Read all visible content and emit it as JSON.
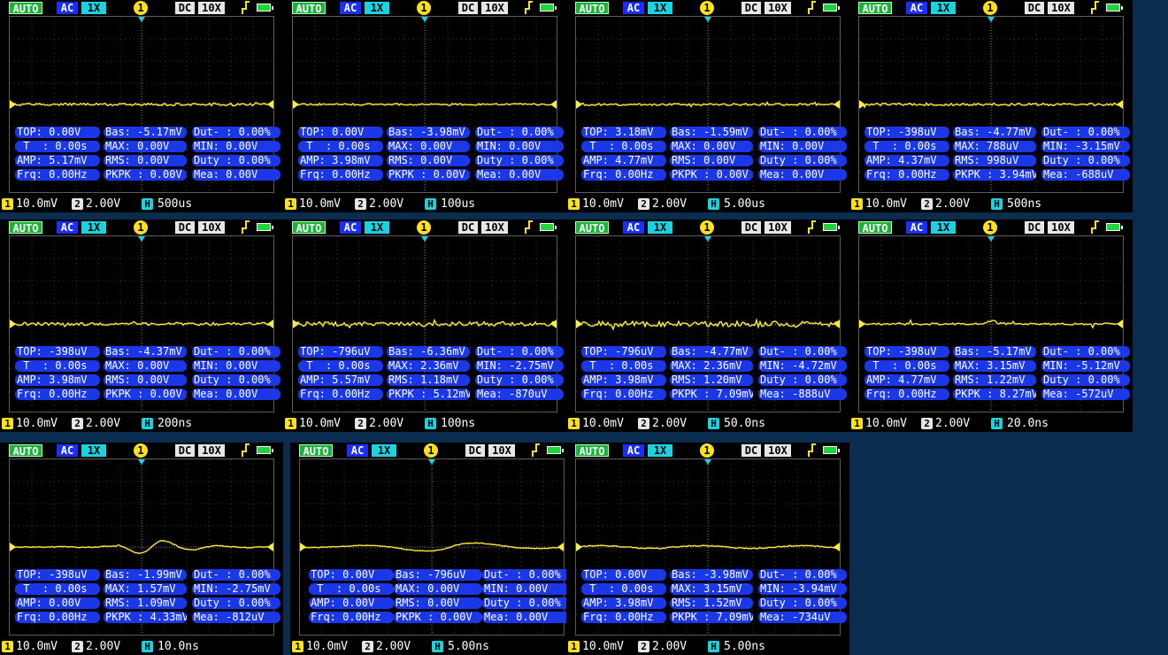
{
  "topbar": {
    "mode": "AUTO",
    "coupling": "AC",
    "probe": "1X",
    "channel": "1",
    "coupling2": "DC",
    "probe2": "10X",
    "trigger_icon": "trigger-edge-icon",
    "battery_icon": "battery-icon"
  },
  "colors": {
    "trace": "#ffeb3b",
    "stat_bg": "#1a37e8",
    "bg": "#0a2d4f"
  },
  "panels": [
    {
      "volts1": "10.0mV",
      "volts2": "2.00V",
      "timebase": "500us",
      "stats": [
        "TOP: 0.00V",
        "Bas: -5.17mV",
        "Dut- : 0.00%",
        " T  : 0.00s",
        "MAX: 0.00V",
        "MIN: 0.00V",
        "AMP: 5.17mV",
        "RMS: 0.00V",
        "Duty : 0.00%",
        "Frq: 0.00Hz",
        "PKPK : 0.00V",
        "Mea: 0.00V"
      ]
    },
    {
      "volts1": "10.0mV",
      "volts2": "2.00V",
      "timebase": "100us",
      "stats": [
        "TOP: 0.00V",
        "Bas: -3.98mV",
        "Dut- : 0.00%",
        " T  : 0.00s",
        "MAX: 0.00V",
        "MIN: 0.00V",
        "AMP: 3.98mV",
        "RMS: 0.00V",
        "Duty : 0.00%",
        "Frq: 0.00Hz",
        "PKPK : 0.00V",
        "Mea: 0.00V"
      ]
    },
    {
      "volts1": "10.0mV",
      "volts2": "2.00V",
      "timebase": "5.00us",
      "stats": [
        "TOP: 3.18mV",
        "Bas: -1.59mV",
        "Dut- : 0.00%",
        " T  : 0.00s",
        "MAX: 0.00V",
        "MIN: 0.00V",
        "AMP: 4.77mV",
        "RMS: 0.00V",
        "Duty : 0.00%",
        "Frq: 0.00Hz",
        "PKPK : 0.00V",
        "Mea: 0.00V"
      ]
    },
    {
      "volts1": "10.0mV",
      "volts2": "2.00V",
      "timebase": "500ns",
      "stats": [
        "TOP: -398uV",
        "Bas: -4.77mV",
        "Dut- : 0.00%",
        " T  : 0.00s",
        "MAX: 788uV",
        "MIN: -3.15mV",
        "AMP: 4.37mV",
        "RMS: 998uV",
        "Duty : 0.00%",
        "Frq: 0.00Hz",
        "PKPK : 3.94mV",
        "Mea: -688uV"
      ]
    },
    {
      "volts1": "10.0mV",
      "volts2": "2.00V",
      "timebase": "200ns",
      "stats": [
        "TOP: -398uV",
        "Bas: -4.37mV",
        "Dut- : 0.00%",
        " T  : 0.00s",
        "MAX: 0.00V",
        "MIN: 0.00V",
        "AMP: 3.98mV",
        "RMS: 0.00V",
        "Duty : 0.00%",
        "Frq: 0.00Hz",
        "PKPK : 0.00V",
        "Mea: 0.00V"
      ]
    },
    {
      "volts1": "10.0mV",
      "volts2": "2.00V",
      "timebase": "100ns",
      "stats": [
        "TOP: -796uV",
        "Bas: -6.36mV",
        "Dut- : 0.00%",
        " T  : 0.00s",
        "MAX: 2.36mV",
        "MIN: -2.75mV",
        "AMP: 5.57mV",
        "RMS: 1.18mV",
        "Duty : 0.00%",
        "Frq: 0.00Hz",
        "PKPK : 5.12mV",
        "Mea: -870uV"
      ]
    },
    {
      "volts1": "10.0mV",
      "volts2": "2.00V",
      "timebase": "50.0ns",
      "stats": [
        "TOP: -796uV",
        "Bas: -4.77mV",
        "Dut- : 0.00%",
        " T  : 0.00s",
        "MAX: 2.36mV",
        "MIN: -4.72mV",
        "AMP: 3.98mV",
        "RMS: 1.20mV",
        "Duty : 0.00%",
        "Frq: 0.00Hz",
        "PKPK : 7.09mV",
        "Mea: -888uV"
      ]
    },
    {
      "volts1": "10.0mV",
      "volts2": "2.00V",
      "timebase": "20.0ns",
      "stats": [
        "TOP: -398uV",
        "Bas: -5.17mV",
        "Dut- : 0.00%",
        " T  : 0.00s",
        "MAX: 3.15mV",
        "MIN: -5.12mV",
        "AMP: 4.77mV",
        "RMS: 1.22mV",
        "Duty : 0.00%",
        "Frq: 0.00Hz",
        "PKPK : 8.27mV",
        "Mea: -572uV"
      ]
    },
    {
      "volts1": "10.0mV",
      "volts2": "2.00V",
      "timebase": "10.0ns",
      "stats": [
        "TOP: -398uV",
        "Bas: -1.99mV",
        "Dut- : 0.00%",
        " T  : 0.00s",
        "MAX: 1.57mV",
        "MIN: -2.75mV",
        "AMP: 0.00V",
        "RMS: 1.09mV",
        "Duty : 0.00%",
        "Frq: 0.00Hz",
        "PKPK : 4.33mV",
        "Mea: -812uV"
      ]
    },
    {
      "volts1": "10.0mV",
      "volts2": "2.00V",
      "timebase": "5.00ns",
      "stats": [
        "TOP: 0.00V",
        "Bas: -796uV",
        "Dut- : 0.00%",
        " T  : 0.00s",
        "MAX: 0.00V",
        "MIN: 0.00V",
        "AMP: 0.00V",
        "RMS: 0.00V",
        "Duty : 0.00%",
        "Frq: 0.00Hz",
        "PKPK : 0.00V",
        "Mea: 0.00V"
      ]
    },
    {
      "volts1": "10.0mV",
      "volts2": "2.00V",
      "timebase": "5.00ns",
      "stats": [
        "TOP: 0.00V",
        "Bas: -3.98mV",
        "Dut- : 0.00%",
        " T  : 0.00s",
        "MAX: 3.15mV",
        "MIN: -3.94mV",
        "AMP: 3.98mV",
        "RMS: 1.52mV",
        "Duty : 0.00%",
        "Frq: 0.00Hz",
        "PKPK : 7.09mV",
        "Mea: -734uV"
      ]
    }
  ]
}
